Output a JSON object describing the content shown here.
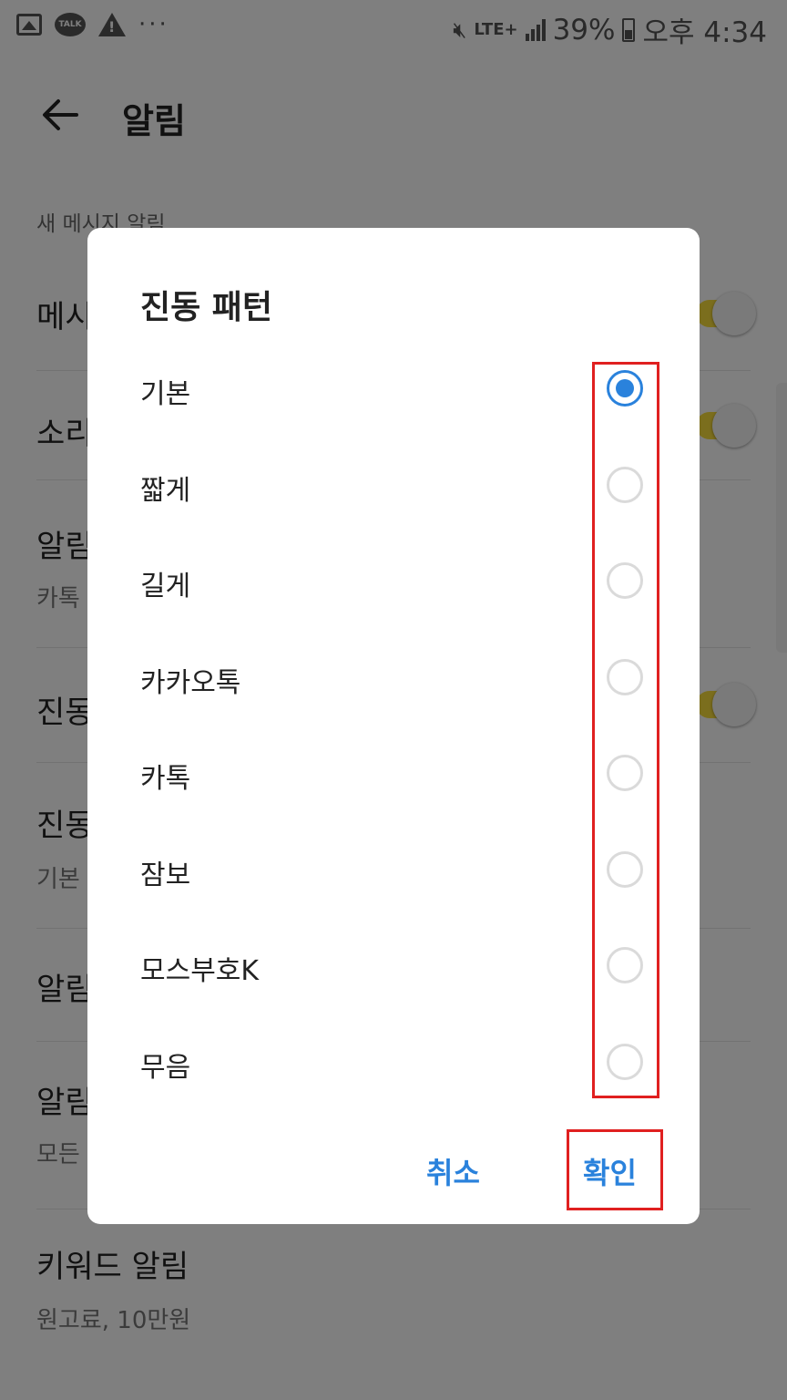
{
  "status_bar": {
    "network": "LTE+",
    "battery": "39%",
    "time": "오후 4:34"
  },
  "app_bar": {
    "title": "알림"
  },
  "background": {
    "section_label": "새 메시지 알림",
    "rows": [
      {
        "title": "메시",
        "subtitle": ""
      },
      {
        "title": "소리",
        "subtitle": ""
      },
      {
        "title": "알림",
        "subtitle": "카톡"
      },
      {
        "title": "진동",
        "subtitle": ""
      },
      {
        "title": "진동",
        "subtitle": "기본"
      },
      {
        "title": "알림",
        "subtitle": ""
      },
      {
        "title": "알림",
        "subtitle": "모든"
      },
      {
        "title": "키워드 알림",
        "subtitle": "원고료, 10만원"
      }
    ]
  },
  "dialog": {
    "title": "진동 패턴",
    "options": [
      {
        "label": "기본",
        "selected": true
      },
      {
        "label": "짧게",
        "selected": false
      },
      {
        "label": "길게",
        "selected": false
      },
      {
        "label": "카카오톡",
        "selected": false
      },
      {
        "label": "카톡",
        "selected": false
      },
      {
        "label": "잠보",
        "selected": false
      },
      {
        "label": "모스부호K",
        "selected": false
      },
      {
        "label": "무음",
        "selected": false
      }
    ],
    "cancel_label": "취소",
    "ok_label": "확인"
  },
  "colors": {
    "accent": "#2a82dc",
    "highlight": "#e02020",
    "toggle_on": "#f7dc3b"
  }
}
